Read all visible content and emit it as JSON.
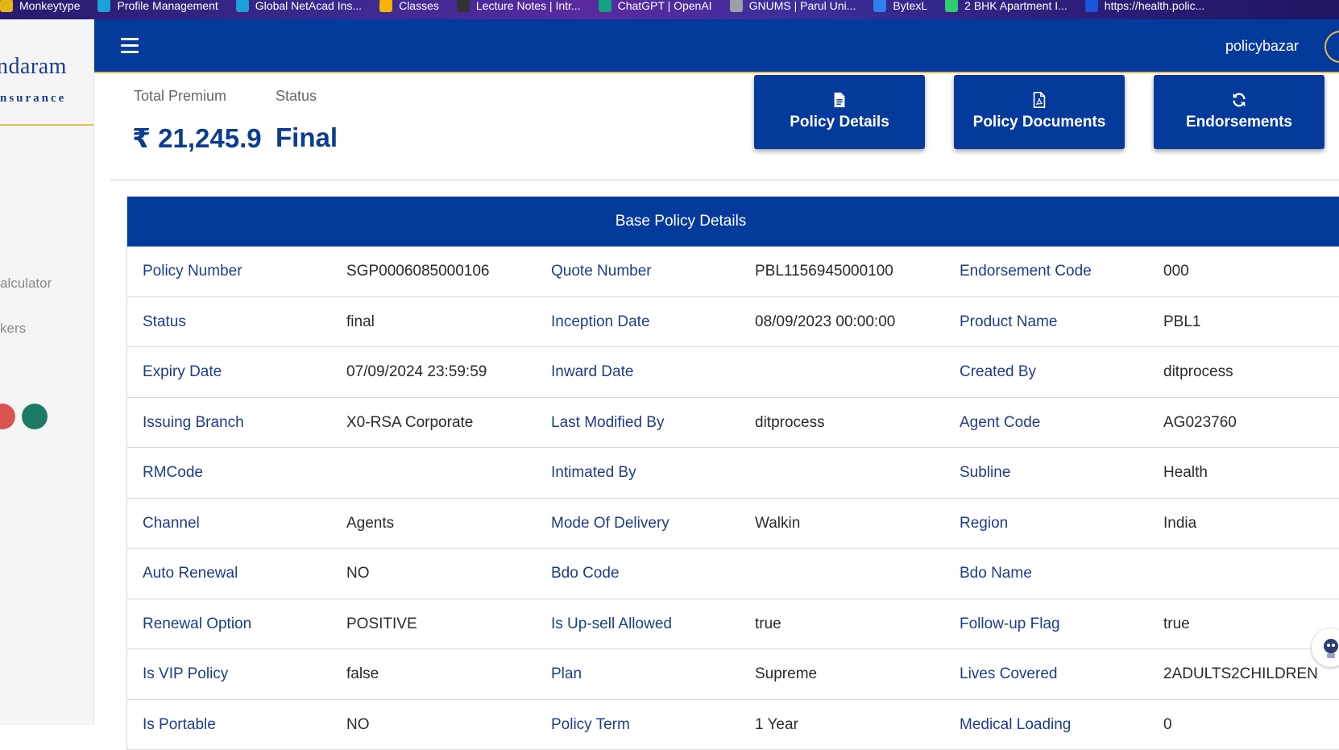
{
  "bookmarks": [
    {
      "label": "Monkeytype",
      "icon": "monkeytype-icon",
      "color": "#e2b714"
    },
    {
      "label": "Profile Management",
      "icon": "cisco-icon",
      "color": "#1ba0d7"
    },
    {
      "label": "Global NetAcad Ins...",
      "icon": "cisco-icon",
      "color": "#1ba0d7"
    },
    {
      "label": "Classes",
      "icon": "classroom-icon",
      "color": "#f4b400"
    },
    {
      "label": "Lecture Notes | Intr...",
      "icon": "ocw-icon",
      "color": "#333333"
    },
    {
      "label": "ChatGPT | OpenAI",
      "icon": "openai-icon",
      "color": "#10a37f"
    },
    {
      "label": "GNUMS | Parul Uni...",
      "icon": "globe-icon",
      "color": "#9aa0a6"
    },
    {
      "label": "BytexL",
      "icon": "bytexl-icon",
      "color": "#2f80ed"
    },
    {
      "label": "2 BHK Apartment I...",
      "icon": "house-icon",
      "color": "#2ecc71"
    },
    {
      "label": "https://health.polic...",
      "icon": "pb-icon",
      "color": "#1a56db"
    }
  ],
  "sidebar": {
    "logo_top": "ndaram",
    "logo_bottom": "nsurance",
    "items": [
      "alculator",
      "kers"
    ],
    "dots": [
      {
        "color": "#d9534f"
      },
      {
        "color": "#1e7b63"
      }
    ]
  },
  "header": {
    "brand": "policybazar",
    "menu_icon": "hamburger-icon"
  },
  "summary": {
    "premium_label": "Total Premium",
    "status_label": "Status",
    "premium_value": "₹ 21,245.9",
    "status_value": "Final"
  },
  "actions": [
    {
      "label": "Policy Details",
      "icon": "file-text-icon"
    },
    {
      "label": "Policy Documents",
      "icon": "file-pdf-icon"
    },
    {
      "label": "Endorsements",
      "icon": "refresh-icon"
    }
  ],
  "table": {
    "title": "Base Policy Details",
    "rows": [
      [
        [
          "Policy Number",
          "SGP0006085000106"
        ],
        [
          "Quote Number",
          "PBL1156945000100"
        ],
        [
          "Endorsement Code",
          "000"
        ]
      ],
      [
        [
          "Status",
          "final"
        ],
        [
          "Inception Date",
          "08/09/2023 00:00:00"
        ],
        [
          "Product Name",
          "PBL1"
        ]
      ],
      [
        [
          "Expiry Date",
          "07/09/2024 23:59:59"
        ],
        [
          "Inward Date",
          ""
        ],
        [
          "Created By",
          "ditprocess"
        ]
      ],
      [
        [
          "Issuing Branch",
          "X0-RSA Corporate"
        ],
        [
          "Last Modified By",
          "ditprocess"
        ],
        [
          "Agent Code",
          "AG023760"
        ]
      ],
      [
        [
          "RMCode",
          ""
        ],
        [
          "Intimated By",
          ""
        ],
        [
          "Subline",
          "Health"
        ]
      ],
      [
        [
          "Channel",
          "Agents"
        ],
        [
          "Mode Of Delivery",
          "Walkin"
        ],
        [
          "Region",
          "India"
        ]
      ],
      [
        [
          "Auto Renewal",
          "NO"
        ],
        [
          "Bdo Code",
          ""
        ],
        [
          "Bdo Name",
          ""
        ]
      ],
      [
        [
          "Renewal Option",
          "POSITIVE"
        ],
        [
          "Is Up-sell Allowed",
          "true"
        ],
        [
          "Follow-up Flag",
          "true"
        ]
      ],
      [
        [
          "Is VIP Policy",
          "false"
        ],
        [
          "Plan",
          "Supreme"
        ],
        [
          "Lives Covered",
          "2ADULTS2CHILDREN"
        ]
      ],
      [
        [
          "Is Portable",
          "NO"
        ],
        [
          "Policy Term",
          "1 Year"
        ],
        [
          "Medical Loading",
          "0"
        ]
      ]
    ]
  },
  "colors": {
    "primary": "#043a9c",
    "accent": "#e9b949",
    "label": "#1f3c88"
  }
}
